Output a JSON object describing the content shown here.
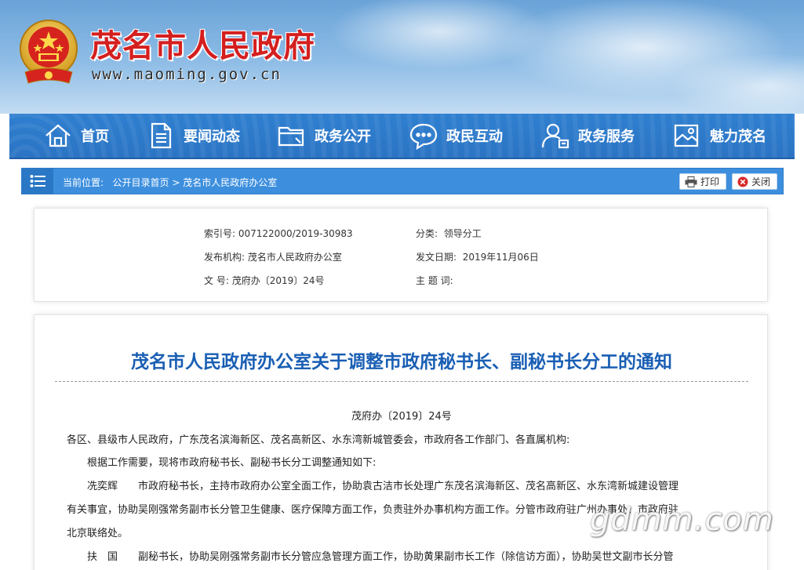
{
  "header": {
    "site_title": "茂名市人民政府",
    "site_url": "www.maoming.gov.cn"
  },
  "nav": {
    "items": [
      {
        "label": "首页",
        "icon": "home-icon"
      },
      {
        "label": "要闻动态",
        "icon": "document-icon"
      },
      {
        "label": "政务公开",
        "icon": "folder-icon"
      },
      {
        "label": "政民互动",
        "icon": "chat-icon"
      },
      {
        "label": "政务服务",
        "icon": "user-service-icon"
      },
      {
        "label": "魅力茂名",
        "icon": "picture-icon"
      }
    ]
  },
  "breadcrumb": {
    "prefix": "当前位置:",
    "home": "公开目录首页",
    "separator": " > ",
    "current": "茂名市人民政府办公室",
    "print_label": "打印",
    "close_label": "关闭"
  },
  "meta": {
    "index_label": "索引号:",
    "index_value": "007122000/2019-30983",
    "category_label": "分类:",
    "category_value": "领导分工",
    "publisher_label": "发布机构:",
    "publisher_value": "茂名市人民政府办公室",
    "date_label": "发文日期:",
    "date_value": "2019年11月06日",
    "docno_label": "文 号:",
    "docno_value": "茂府办〔2019〕24号",
    "keywords_label": "主 题 词:",
    "keywords_value": ""
  },
  "article": {
    "title": "茂名市人民政府办公室关于调整市政府秘书长、副秘书长分工的通知",
    "doc_number": "茂府办〔2019〕24号",
    "lines": [
      "各区、县级市人民政府，广东茂名滨海新区、茂名高新区、水东湾新城管委会，市政府各工作部门、各直属机构:",
      "根据工作需要，现将市政府秘书长、副秘书长分工调整通知如下:",
      "冼奕辉　　市政府秘书长，主持市政府办公室全面工作，协助袁古洁市长处理广东茂名滨海新区、茂名高新区、水东湾新城建设管理",
      "有关事宜，协助吴刚强常务副市长分管卫生健康、医疗保障方面工作，负责驻外办事机构方面工作。分管市政府驻广州办事处、市政府驻",
      "北京联络处。",
      "扶　国　　副秘书长，协助吴刚强常务副市长分管应急管理方面工作，协助黄果副市长工作（除信访方面），协助吴世文副市长分管"
    ]
  },
  "watermark": "gdmm.com",
  "colors": {
    "title_red": "#d41f1f",
    "nav_blue": "#2b74c4",
    "article_title_blue": "#1a5fb4"
  }
}
